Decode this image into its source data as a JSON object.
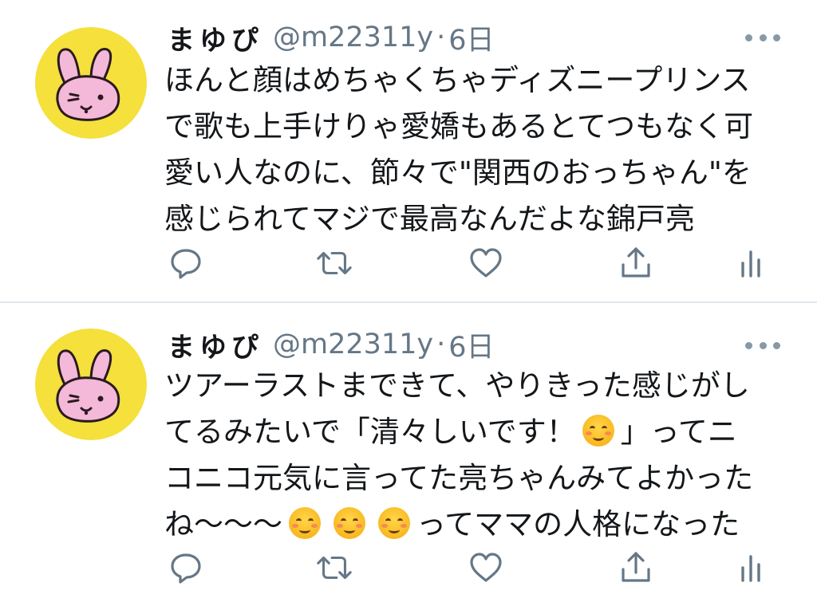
{
  "tweets": [
    {
      "display_name": "まゆぴ",
      "handle": "@m22311y",
      "separator": "·",
      "time": "6日",
      "lines": [
        "ほんと顔はめちゃくちゃディズニープリンス",
        "で歌も上手けりゃ愛嬌もあるとてつもなく可",
        "愛い人なのに、節々で\"関西のおっちゃん\"を",
        "感じられてマジで最高なんだよな錦戸亮"
      ],
      "avatar": {
        "background": "#f5e03c",
        "figure": "pink-bunny"
      },
      "actions": [
        "reply-icon",
        "retweet-icon",
        "like-icon",
        "share-icon",
        "analytics-icon"
      ]
    },
    {
      "display_name": "まゆぴ",
      "handle": "@m22311y",
      "separator": "·",
      "time": "6日",
      "lines": [
        {
          "text": "ツアーラストまできて、やりきった感じがし"
        },
        {
          "pre": "てるみたいで「清々しいです！",
          "emoji_count": 1,
          "post": "」ってニ"
        },
        {
          "text": "コニコ元気に言ってた亮ちゃんみてよかった"
        },
        {
          "pre": "ね〜〜〜",
          "emoji_count": 3,
          "post": "ってママの人格になった"
        }
      ],
      "emoji": "smiling-face-emoji",
      "avatar": {
        "background": "#f5e03c",
        "figure": "pink-bunny"
      },
      "actions": [
        "reply-icon",
        "retweet-icon",
        "like-icon",
        "share-icon",
        "analytics-icon"
      ]
    }
  ],
  "colors": {
    "text": "#14171a",
    "secondary": "#657786",
    "icon": "#657786",
    "divider": "#e1e8ed",
    "avatar": "#f5e03c",
    "bunny": "#f4b8d8"
  }
}
